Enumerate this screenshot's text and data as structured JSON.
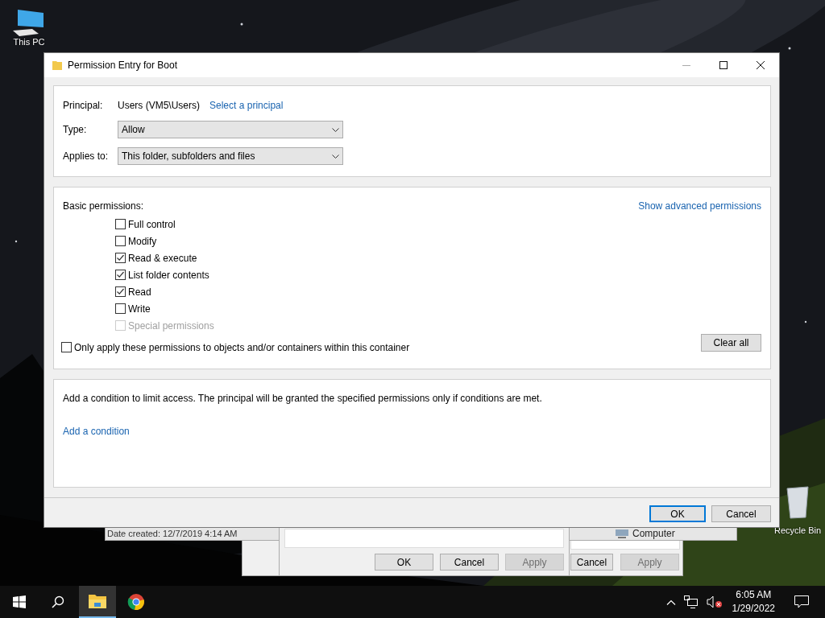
{
  "desktop_icons": [
    {
      "kind": "pc",
      "label": "This PC"
    },
    {
      "kind": "bin",
      "label": "Recycle Bin"
    }
  ],
  "details_window": {
    "date_created": "Date created: 12/7/2019 4:14 AM",
    "location": "Computer"
  },
  "back_dialogs": [
    {
      "buttons": [
        {
          "label": "OK",
          "disabled": false
        },
        {
          "label": "Cancel",
          "disabled": false
        },
        {
          "label": "Apply",
          "disabled": true
        }
      ]
    },
    {
      "buttons": [
        {
          "label": "Cancel",
          "disabled": false
        },
        {
          "label": "Apply",
          "disabled": true
        }
      ]
    }
  ],
  "dialog": {
    "title": "Permission Entry for Boot",
    "principal_label": "Principal:",
    "principal": "Users (VM5\\Users)",
    "select_link": "Select a principal",
    "type_label": "Type:",
    "type_value": "Allow",
    "applies_label": "Applies to:",
    "applies_value": "This folder, subfolders and files",
    "basic_label": "Basic permissions:",
    "advanced_link": "Show advanced permissions",
    "permissions": [
      {
        "label": "Full control",
        "checked": false,
        "disabled": false
      },
      {
        "label": "Modify",
        "checked": false,
        "disabled": false
      },
      {
        "label": "Read & execute",
        "checked": true,
        "disabled": false
      },
      {
        "label": "List folder contents",
        "checked": true,
        "disabled": false
      },
      {
        "label": "Read",
        "checked": true,
        "disabled": false
      },
      {
        "label": "Write",
        "checked": false,
        "disabled": false
      },
      {
        "label": "Special permissions",
        "checked": false,
        "disabled": true
      }
    ],
    "only_apply": {
      "label": "Only apply these permissions to objects and/or containers within this container",
      "checked": false
    },
    "clear_button": "Clear all",
    "condition_text": "Add a condition to limit access. The principal will be granted the specified permissions only if conditions are met.",
    "condition_link": "Add a condition",
    "buttons": [
      {
        "label": "OK",
        "focused": true
      },
      {
        "label": "Cancel",
        "focused": false
      }
    ]
  },
  "taskbar": {
    "apps": [
      {
        "kind": "explorer",
        "selected": true
      },
      {
        "kind": "browser",
        "selected": false
      }
    ],
    "time": "6:05 AM",
    "date": "1/29/2022"
  }
}
